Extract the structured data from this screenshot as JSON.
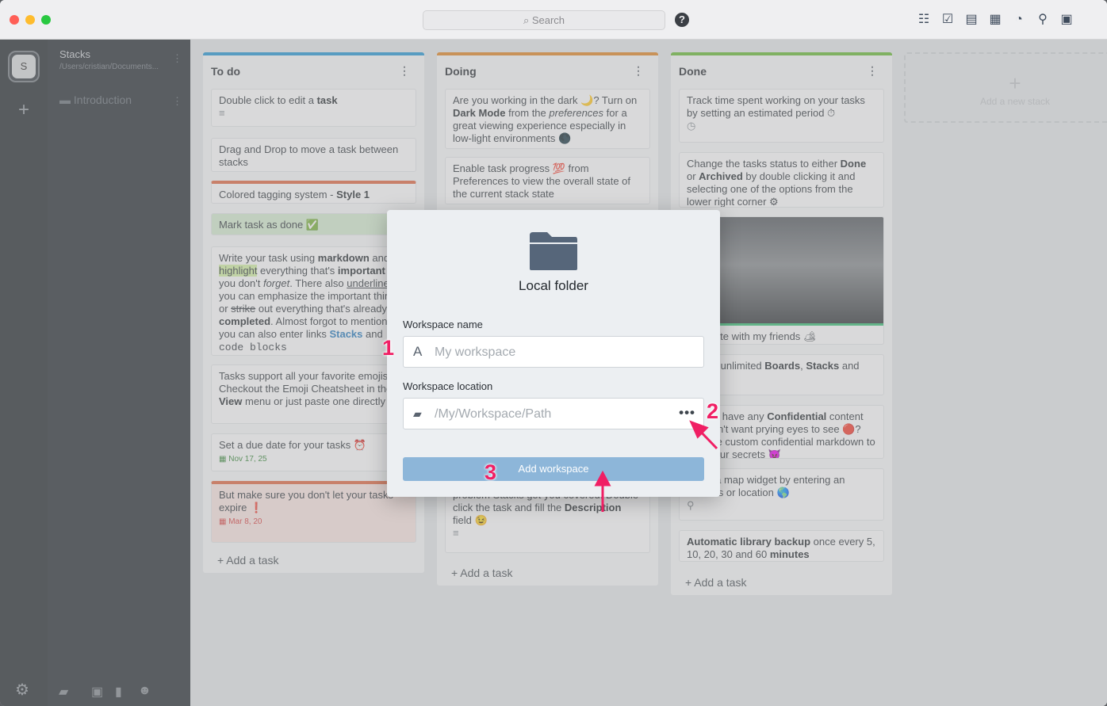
{
  "titlebar": {
    "search_placeholder": "Search",
    "help_label": "?"
  },
  "toolbar_icons": [
    "list-view-icon",
    "checklist-icon",
    "table-view-icon",
    "calendar-icon",
    "dashboard-icon",
    "location-pin-icon",
    "archive-icon"
  ],
  "rail": {
    "workspace_initial": "S",
    "add_label": "+",
    "settings_label": "⚙"
  },
  "sidebar": {
    "title": "Stacks",
    "path": "/Users/cristian/Documents...",
    "item": "Introduction"
  },
  "columns": {
    "todo": {
      "title": "To do",
      "color": "#2c9ad6",
      "add_task": "Add a task"
    },
    "doing": {
      "title": "Doing",
      "color": "#e08a2e",
      "add_task": "Add a task"
    },
    "done": {
      "title": "Done",
      "color": "#6cbb3c",
      "add_task": "Add a task"
    }
  },
  "new_stack": "Add a new stack",
  "modal": {
    "title": "Local folder",
    "name_label": "Workspace name",
    "name_placeholder": "My workspace",
    "location_label": "Workspace location",
    "location_placeholder": "/My/Workspace/Path",
    "more_label": "•••",
    "submit_label": "Add workspace"
  },
  "callouts": {
    "one": "1",
    "two": "2",
    "three": "3"
  },
  "accent_color": "#f01f64"
}
